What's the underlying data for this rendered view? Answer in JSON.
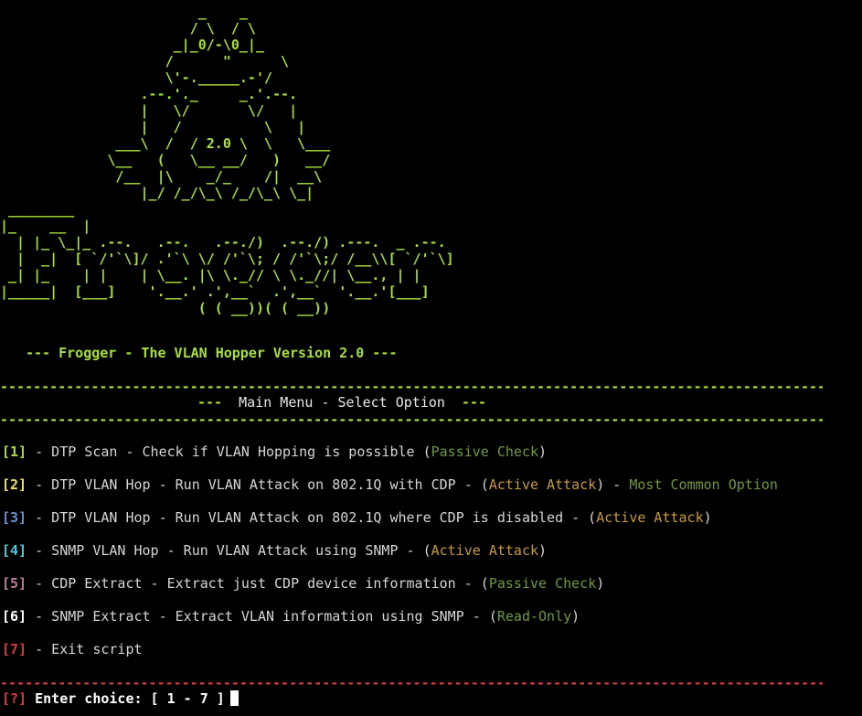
{
  "ascii_art": {
    "frog": "                        _    _\n                       / \\  / \\\n                     _|_0/-\\0_|_\n                    /      \"      \\\n                    \\'-._____.-'/\n                 .--.'._     _.'.--.\n                 |   \\/       \\/   |\n                 |   /          \\   |\n              ___\\  /  / 2.0 \\  \\   \\___\n             \\__   (   \\__ __/   )   __/\n              /__  |\\    _/_    /|  __\\\n                 |_/ /_/\\_\\ /_/\\_\\ \\_|",
    "logo": " ________\n|_    __  |\n  | |_ \\_|_ .--.   .--.   .--./)  .--./) .---.  _ .--.\n  |  _|  [ `/'`\\]/ .'`\\ \\/ /'`\\; / /'`\\;/ /__\\\\[ `/'`\\]\n _| |_    | |    | \\__. |\\ \\._// \\ \\._//| \\__., | |\n|_____|  [___]    '.__.' .',__`  .',__`  '.__.'[___]\n                        ( ( __))( ( __))"
  },
  "title": "--- Frogger - The VLAN Hopper Version 2.0 ---",
  "separator": "------------------------------------------------------------------------------------------------------------------",
  "menu_header": {
    "left_dashes": "---",
    "text": "Main Menu - Select Option",
    "right_dashes": "---"
  },
  "menu_items": [
    {
      "num": "[1]",
      "color": "#a8df3c",
      "text": " - DTP Scan - Check if VLAN Hopping is possible (",
      "tag": "Passive Check",
      "tag_color": "#6e9a3c",
      "after": ")",
      "extra_sep": "",
      "extra": "",
      "extra_color": ""
    },
    {
      "num": "[2]",
      "color": "#f0e060",
      "text": " - DTP VLAN Hop - Run VLAN Attack on 802.1Q with CDP - (",
      "tag": "Active Attack",
      "tag_color": "#c69a3a",
      "after": ")",
      "extra_sep": " - ",
      "extra": "Most Common Option",
      "extra_color": "#6e9a3c"
    },
    {
      "num": "[3]",
      "color": "#6a8fd8",
      "text": " - DTP VLAN Hop - Run VLAN Attack on 802.1Q where CDP is disabled - (",
      "tag": "Active Attack",
      "tag_color": "#c69a3a",
      "after": ")",
      "extra_sep": "",
      "extra": "",
      "extra_color": ""
    },
    {
      "num": "[4]",
      "color": "#4fc8d8",
      "text": " - SNMP VLAN Hop - Run VLAN Attack using SNMP - (",
      "tag": "Active Attack",
      "tag_color": "#c69a3a",
      "after": ")",
      "extra_sep": "",
      "extra": "",
      "extra_color": ""
    },
    {
      "num": "[5]",
      "color": "#c07898",
      "text": " - CDP Extract - Extract just CDP device information - (",
      "tag": "Passive Check",
      "tag_color": "#6e9a3c",
      "after": ")",
      "extra_sep": "",
      "extra": "",
      "extra_color": ""
    },
    {
      "num": "[6]",
      "color": "#ffffff",
      "text": " - SNMP Extract - Extract VLAN information using SNMP - (",
      "tag": "Read-Only",
      "tag_color": "#6e9a3c",
      "after": ")",
      "extra_sep": "",
      "extra": "",
      "extra_color": ""
    },
    {
      "num": "[7]",
      "color": "#d83a3a",
      "text": " - Exit script",
      "tag": "",
      "tag_color": "",
      "after": "",
      "extra_sep": "",
      "extra": "",
      "extra_color": ""
    }
  ],
  "prompt": {
    "marker": "[?]",
    "text": " Enter choice: [ 1 - 7 ]"
  }
}
